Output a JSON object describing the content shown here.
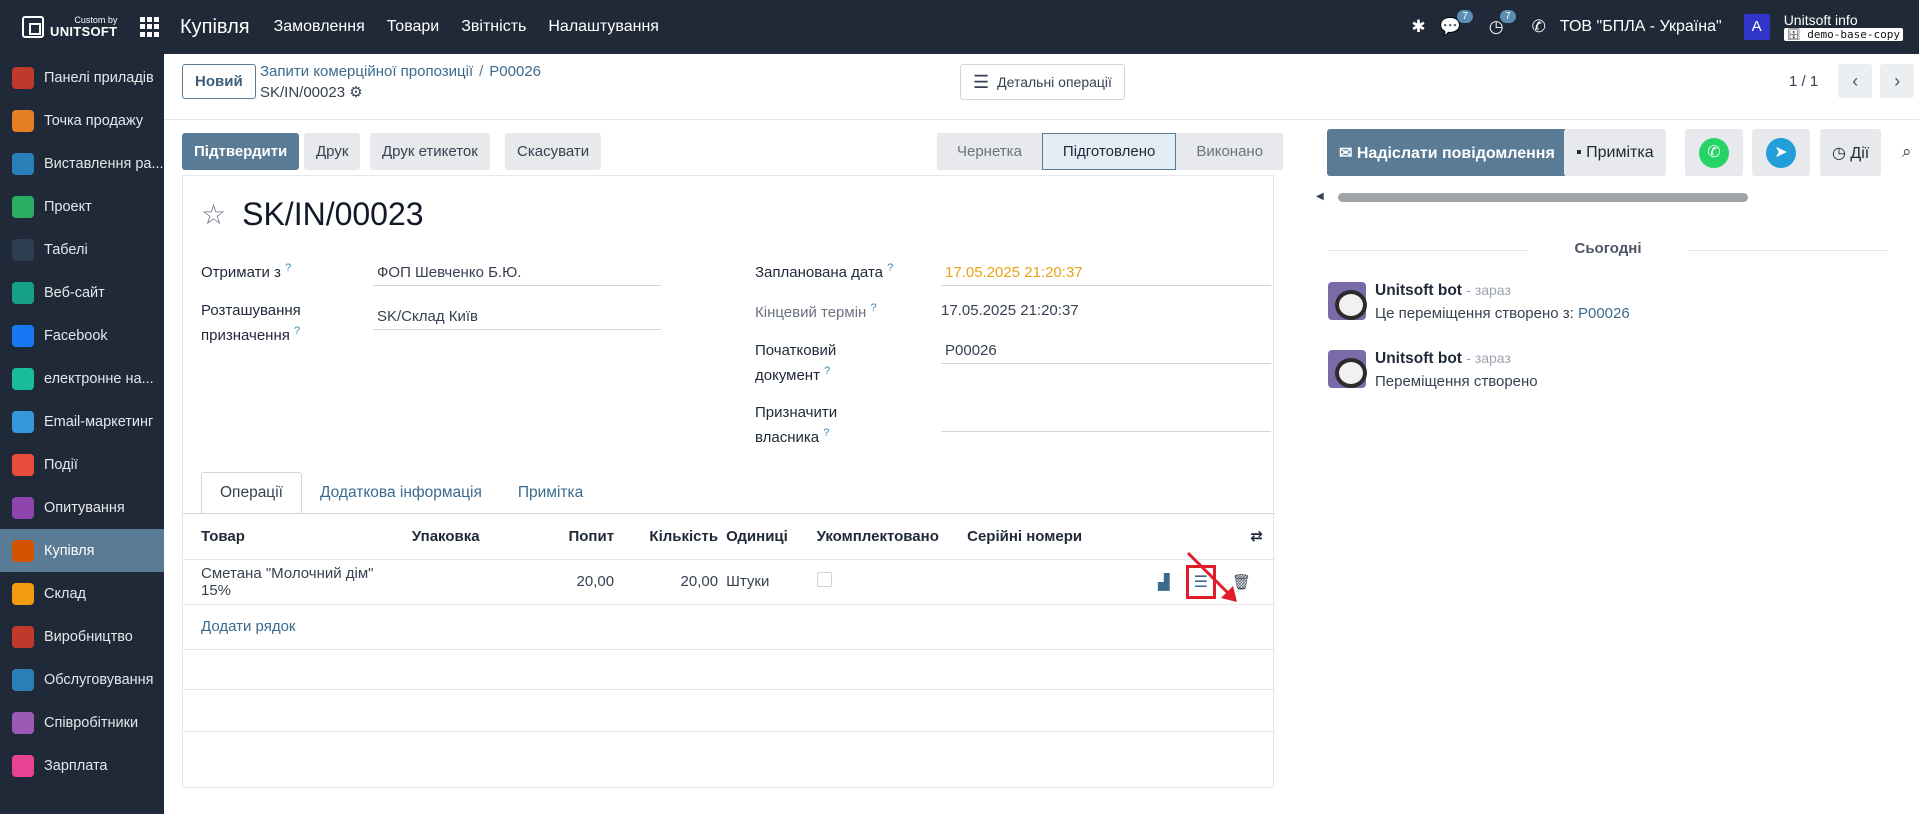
{
  "navbar": {
    "brand_small": "Custom by",
    "brand_big": "UNITSOFT",
    "app_name": "Купівля",
    "menu": [
      "Замовлення",
      "Товари",
      "Звітність",
      "Налаштування"
    ],
    "messages_badge": "7",
    "activities_badge": "7",
    "company": "ТОВ \"БПЛА - Україна\"",
    "avatar_letter": "A",
    "user_name": "Unitsoft info",
    "database": "demo-base-copy"
  },
  "sidebar": {
    "items": [
      {
        "label": "Панелі приладів",
        "color": "#c0392b"
      },
      {
        "label": "Точка продажу",
        "color": "#e67e22"
      },
      {
        "label": "Виставлення ра...",
        "color": "#2980b9"
      },
      {
        "label": "Проект",
        "color": "#27ae60"
      },
      {
        "label": "Табелі",
        "color": "#2c3e50"
      },
      {
        "label": "Веб-сайт",
        "color": "#16a085"
      },
      {
        "label": "Facebook",
        "color": "#1877f2"
      },
      {
        "label": "електронне на...",
        "color": "#1abc9c"
      },
      {
        "label": "Email-маркетинг",
        "color": "#3498db"
      },
      {
        "label": "Події",
        "color": "#e74c3c"
      },
      {
        "label": "Опитування",
        "color": "#8e44ad"
      },
      {
        "label": "Купівля",
        "color": "#d35400"
      },
      {
        "label": "Склад",
        "color": "#f39c12"
      },
      {
        "label": "Виробництво",
        "color": "#c0392b"
      },
      {
        "label": "Обслуговування",
        "color": "#2980b9"
      },
      {
        "label": "Співробітники",
        "color": "#9b59b6"
      },
      {
        "label": "Зарплата",
        "color": "#e84393"
      }
    ]
  },
  "control_panel": {
    "new_button": "Новий",
    "breadcrumb_parent": "Запити комерційної пропозиції",
    "breadcrumb_current": "P00026",
    "record_name": "SK/IN/00023",
    "detailed_ops_button": "Детальні операції",
    "pager": "1 / 1"
  },
  "actions": {
    "confirm": "Підтвердити",
    "print": "Друк",
    "print_labels": "Друк етикеток",
    "cancel": "Скасувати"
  },
  "stages": {
    "draft": "Чернетка",
    "ready": "Підготовлено",
    "done": "Виконано"
  },
  "form": {
    "title": "SK/IN/00023",
    "receive_from_label": "Отримати з",
    "receive_from_value": "ФОП Шевченко Б.Ю.",
    "dest_location_label_1": "Розташування",
    "dest_location_label_2": "призначення",
    "dest_location_value": "SK/Склад Київ",
    "scheduled_date_label": "Запланована дата",
    "scheduled_date_value": "17.05.2025 21:20:37",
    "deadline_label": "Кінцевий термін",
    "deadline_value": "17.05.2025 21:20:37",
    "source_doc_label_1": "Початковий",
    "source_doc_label_2": "документ",
    "source_doc_value": "P00026",
    "owner_label_1": "Призначити",
    "owner_label_2": "власника",
    "help_mark": "?"
  },
  "tabs": [
    "Операції",
    "Додаткова інформація",
    "Примітка"
  ],
  "lines": {
    "headers": [
      "Товар",
      "Упаковка",
      "Попит",
      "Кількість",
      "Одиниці",
      "Укомплектовано",
      "Серійні номери"
    ],
    "rows": [
      {
        "product": "Сметана \"Молочний дім\" 15%",
        "packaging": "",
        "demand": "20,00",
        "quantity": "20,00",
        "uom": "Штуки"
      }
    ],
    "add_line": "Додати рядок"
  },
  "chatter": {
    "send_message": "Надіслати повідомлення",
    "log_note": "Примітка",
    "activities": "Дії",
    "today": "Сьогодні",
    "messages": [
      {
        "author": "Unitsoft bot",
        "time": "- зараз",
        "body": "Це переміщення створено з:",
        "link": "P00026"
      },
      {
        "author": "Unitsoft bot",
        "time": "- зараз",
        "body": "Переміщення створено",
        "link": ""
      }
    ]
  }
}
